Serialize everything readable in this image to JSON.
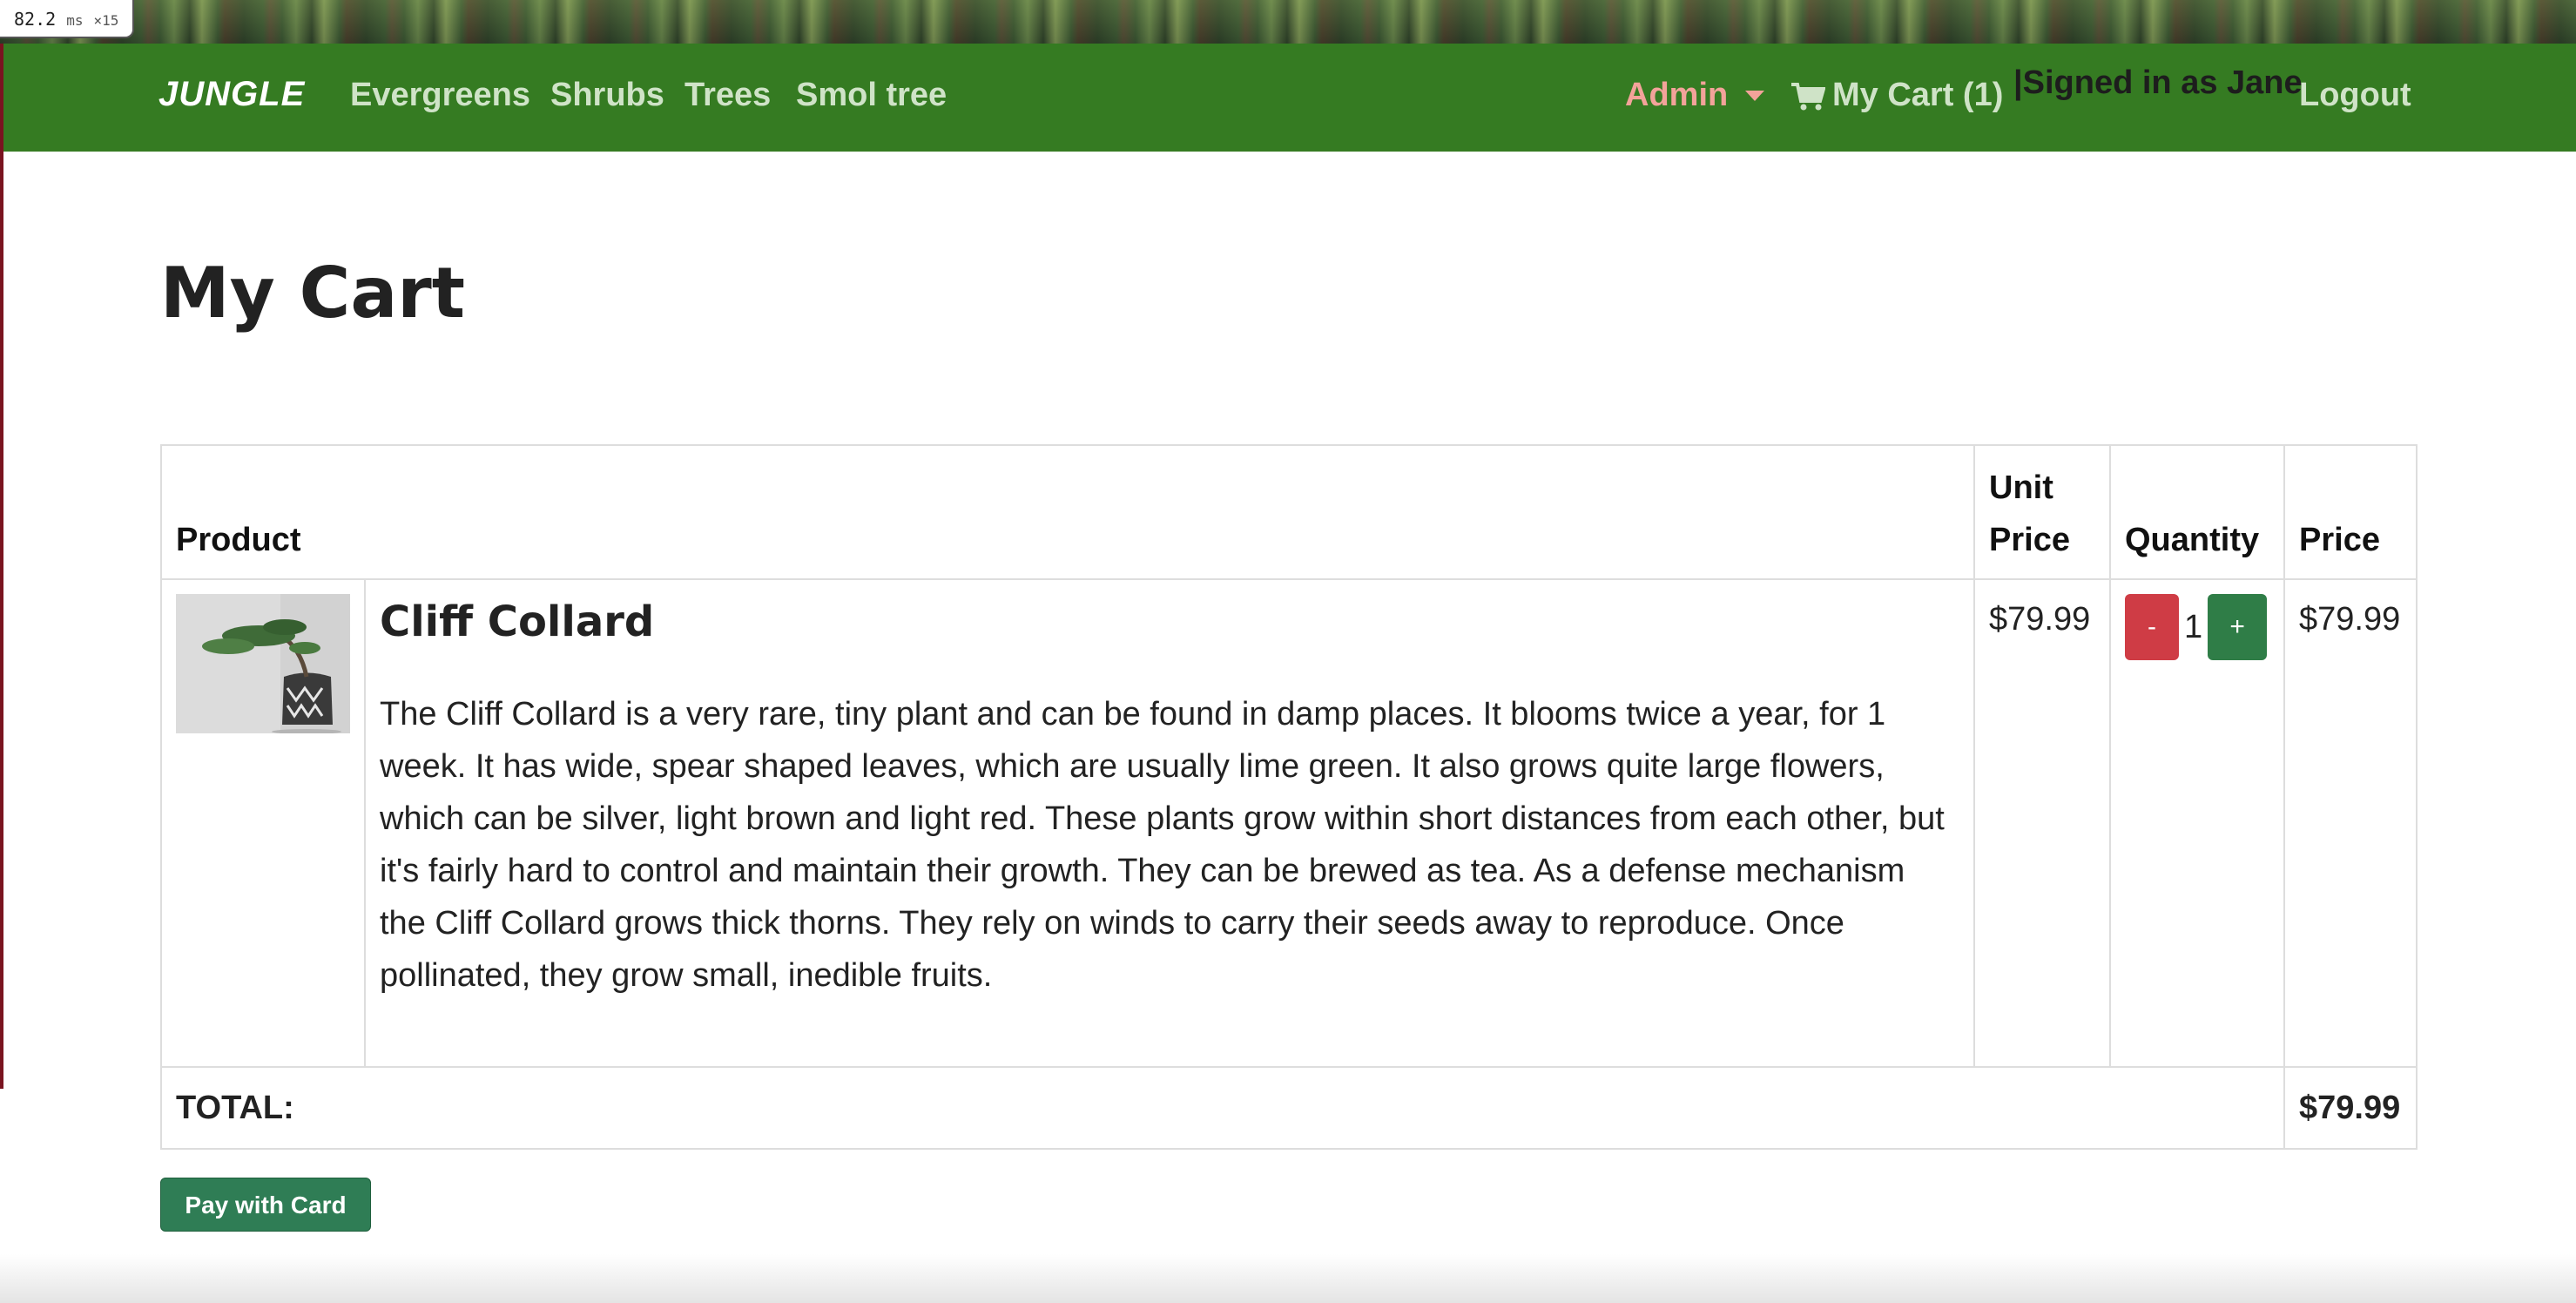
{
  "perf": {
    "ms": "82.2",
    "unit": "ms",
    "multiplier": "×15"
  },
  "nav": {
    "brand": "JUNGLE",
    "links": [
      "Evergreens",
      "Shrubs",
      "Trees",
      "Smol tree"
    ],
    "admin": "Admin",
    "cart": "My Cart (1)",
    "signed_in": "|Signed in as Jane",
    "logout": "Logout"
  },
  "page": {
    "title": "My Cart"
  },
  "table": {
    "headers": {
      "product": "Product",
      "unit_price_1": "Unit",
      "unit_price_2": "Price",
      "quantity": "Quantity",
      "price": "Price"
    },
    "items": [
      {
        "name": "Cliff Collard",
        "description": "The Cliff Collard is a very rare, tiny plant and can be found in damp places. It blooms twice a year, for 1 week. It has wide, spear shaped leaves, which are usually lime green. It also grows quite large flowers, which can be silver, light brown and light red. These plants grow within short distances from each other, but it's fairly hard to control and maintain their growth. They can be brewed as tea. As a defense mechanism the Cliff Collard grows thick thorns. They rely on winds to carry their seeds away to reproduce. Once pollinated, they grow small, inedible fruits.",
        "unit_price": "$79.99",
        "quantity": "1",
        "price": "$79.99",
        "minus": "-",
        "plus": "+"
      }
    ],
    "total_label": "TOTAL:",
    "total_value": "$79.99"
  },
  "pay_button": "Pay with Card",
  "colors": {
    "navbar": "#357b22",
    "minus": "#cf3c45",
    "plus": "#2f7d47",
    "pay": "#2f7d55",
    "admin": "#f3a39a"
  },
  "icons": [
    "cart-icon",
    "caret-down-icon",
    "product-image"
  ]
}
